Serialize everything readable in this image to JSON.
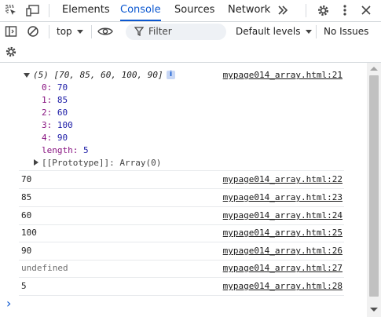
{
  "tabs": {
    "elements": "Elements",
    "console": "Console",
    "sources": "Sources",
    "network": "Network"
  },
  "toolbar": {
    "context": "top",
    "filter_placeholder": "Filter",
    "levels": "Default levels",
    "issues": "No Issues"
  },
  "array_log": {
    "summary": "(5) [70, 85, 60, 100, 90]",
    "info_badge": "i",
    "source": "mypage014_array.html:21",
    "entries": [
      {
        "key": "0:",
        "value": "70"
      },
      {
        "key": "1:",
        "value": "85"
      },
      {
        "key": "2:",
        "value": "60"
      },
      {
        "key": "3:",
        "value": "100"
      },
      {
        "key": "4:",
        "value": "90"
      }
    ],
    "length_key": "length:",
    "length_value": "5",
    "prototype": "[[Prototype]]: Array(0)"
  },
  "messages": [
    {
      "text": "70",
      "source": "mypage014_array.html:22"
    },
    {
      "text": "85",
      "source": "mypage014_array.html:23"
    },
    {
      "text": "60",
      "source": "mypage014_array.html:24"
    },
    {
      "text": "100",
      "source": "mypage014_array.html:25"
    },
    {
      "text": "90",
      "source": "mypage014_array.html:26"
    },
    {
      "text": "undefined",
      "source": "mypage014_array.html:27"
    },
    {
      "text": "5",
      "source": "mypage014_array.html:28"
    }
  ],
  "prompt_symbol": "›",
  "colors": {
    "accent": "#0b57d0",
    "key": "#881280",
    "number": "#1a1aa6",
    "muted": "#6e6e6e"
  }
}
